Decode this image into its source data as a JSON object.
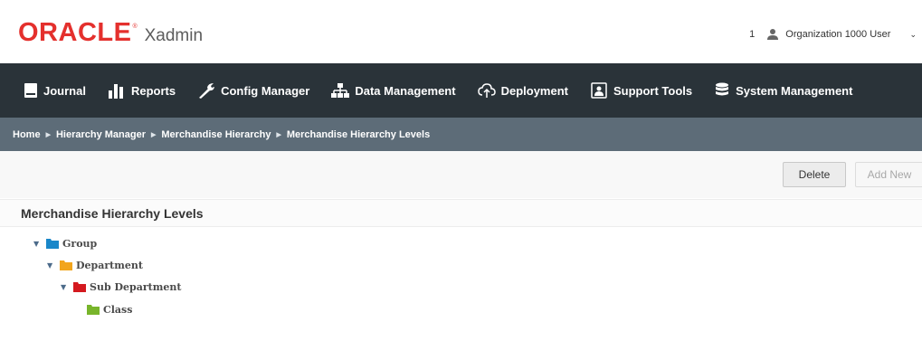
{
  "header": {
    "brand": "ORACLE",
    "trademark": "®",
    "app_name": "Xadmin",
    "user_count": "1",
    "user_name": "Organization 1000 User",
    "caret": "⌄"
  },
  "nav": {
    "items": [
      {
        "label": "Journal",
        "icon": "journal-icon"
      },
      {
        "label": "Reports",
        "icon": "bar-chart-icon"
      },
      {
        "label": "Config Manager",
        "icon": "wrench-icon"
      },
      {
        "label": "Data Management",
        "icon": "hierarchy-icon"
      },
      {
        "label": "Deployment",
        "icon": "cloud-upload-icon"
      },
      {
        "label": "Support Tools",
        "icon": "support-icon"
      },
      {
        "label": "System Management",
        "icon": "database-icon"
      }
    ]
  },
  "breadcrumb": {
    "items": [
      "Home",
      "Hierarchy Manager",
      "Merchandise Hierarchy",
      "Merchandise Hierarchy Levels"
    ],
    "separator": "▶"
  },
  "toolbar": {
    "delete_label": "Delete",
    "add_new_label": "Add New"
  },
  "panel": {
    "title": "Merchandise Hierarchy Levels"
  },
  "tree": {
    "expanded_glyph": "▼",
    "nodes": [
      {
        "label": "Group",
        "color": "#1a87c9",
        "level": 0,
        "expanded": true
      },
      {
        "label": "Department",
        "color": "#f2a51c",
        "level": 1,
        "expanded": true
      },
      {
        "label": "Sub Department",
        "color": "#d4191f",
        "level": 2,
        "expanded": true
      },
      {
        "label": "Class",
        "color": "#78b52b",
        "level": 3,
        "expanded": false
      }
    ]
  },
  "colors": {
    "brand_red": "#e4302d",
    "navbar": "#2a3339",
    "breadcrumb_bar": "#5d6c78"
  }
}
